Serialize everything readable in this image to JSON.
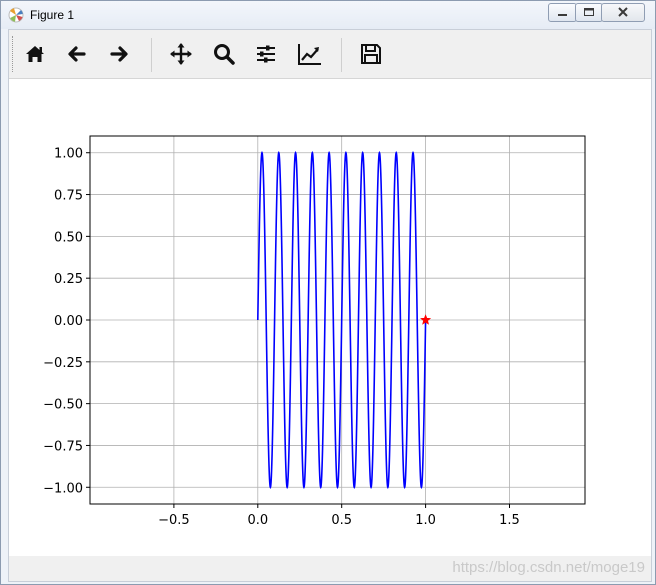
{
  "window": {
    "title": "Figure 1",
    "controls": [
      "minimize",
      "maximize",
      "close"
    ]
  },
  "toolbar": {
    "buttons": [
      {
        "name": "home-icon",
        "tooltip": "Home"
      },
      {
        "name": "back-arrow-icon",
        "tooltip": "Back"
      },
      {
        "name": "forward-arrow-icon",
        "tooltip": "Forward"
      },
      {
        "name": "pan-icon",
        "tooltip": "Pan"
      },
      {
        "name": "zoom-icon",
        "tooltip": "Zoom"
      },
      {
        "name": "subplots-config-icon",
        "tooltip": "Configure subplots"
      },
      {
        "name": "edit-axis-icon",
        "tooltip": "Edit axis"
      },
      {
        "name": "save-icon",
        "tooltip": "Save"
      }
    ]
  },
  "statusbar": {
    "watermark": "https://blog.csdn.net/moge19"
  },
  "chart_data": {
    "type": "line",
    "xlim": [
      -1.0,
      1.95
    ],
    "ylim": [
      -1.1,
      1.1
    ],
    "xticks": [
      -0.5,
      0.0,
      0.5,
      1.0,
      1.5
    ],
    "xtick_labels": [
      "−0.5",
      "0.0",
      "0.5",
      "1.0",
      "1.5"
    ],
    "yticks": [
      1.0,
      0.75,
      0.5,
      0.25,
      0.0,
      -0.25,
      -0.5,
      -0.75,
      -1.0
    ],
    "ytick_labels": [
      "1.00",
      "0.75",
      "0.50",
      "0.25",
      "0.00",
      "−0.25",
      "−0.50",
      "−0.75",
      "−1.00"
    ],
    "grid": true,
    "series": [
      {
        "kind": "line",
        "function": "sin(2*pi*10*x)",
        "x_range": [
          0.0,
          1.0
        ],
        "samples": 1000,
        "color": "#0000ff"
      },
      {
        "kind": "marker",
        "marker": "star",
        "x": [
          1.0
        ],
        "y": [
          0.0
        ],
        "color": "#ff0000"
      }
    ]
  }
}
